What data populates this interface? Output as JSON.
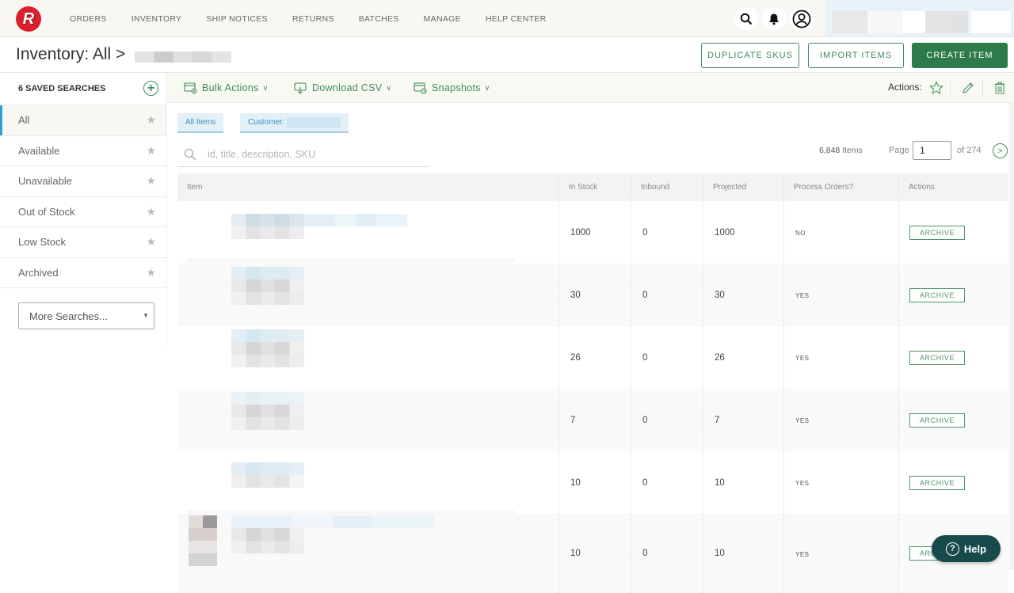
{
  "nav": {
    "logo_letter": "R",
    "items": [
      "ORDERS",
      "INVENTORY",
      "SHIP NOTICES",
      "RETURNS",
      "BATCHES",
      "MANAGE",
      "HELP CENTER"
    ],
    "icons": [
      "search-icon",
      "bell-icon",
      "user-icon"
    ]
  },
  "header": {
    "title": "Inventory: All >",
    "buttons": {
      "duplicate_skus": "DUPLICATE SKUS",
      "import_items": "IMPORT ITEMS",
      "create_item": "CREATE ITEM"
    }
  },
  "sidebar": {
    "heading": "6 SAVED SEARCHES",
    "items": [
      {
        "label": "All",
        "active": true
      },
      {
        "label": "Available"
      },
      {
        "label": "Unavailable"
      },
      {
        "label": "Out of Stock"
      },
      {
        "label": "Low Stock"
      },
      {
        "label": "Archived"
      }
    ],
    "more_searches": "More Searches..."
  },
  "toolbar": {
    "bulk_actions": "Bulk Actions",
    "download_csv": "Download CSV",
    "snapshots": "Snapshots",
    "actions_label": "Actions:"
  },
  "filters": {
    "all_items": "All Items",
    "customer": "Customer:"
  },
  "search": {
    "placeholder": "id, title, description, SKU",
    "value": ""
  },
  "pagination": {
    "items_count": "6,848",
    "items_label": "Items",
    "page_label": "Page",
    "current_page": "1",
    "of_label": "of 274"
  },
  "table": {
    "columns": [
      "Item",
      "In Stock",
      "Inbound",
      "Projected",
      "Process Orders?",
      "Actions"
    ],
    "rows": [
      {
        "in_stock": "1000",
        "inbound": "0",
        "projected": "1000",
        "process_orders": "NO",
        "action": "ARCHIVE"
      },
      {
        "in_stock": "30",
        "inbound": "0",
        "projected": "30",
        "process_orders": "YES",
        "action": "ARCHIVE"
      },
      {
        "in_stock": "26",
        "inbound": "0",
        "projected": "26",
        "process_orders": "YES",
        "action": "ARCHIVE"
      },
      {
        "in_stock": "7",
        "inbound": "0",
        "projected": "7",
        "process_orders": "YES",
        "action": "ARCHIVE"
      },
      {
        "in_stock": "10",
        "inbound": "0",
        "projected": "10",
        "process_orders": "YES",
        "action": "ARCHIVE"
      },
      {
        "in_stock": "10",
        "inbound": "0",
        "projected": "10",
        "process_orders": "YES",
        "action": "ARCHIVE"
      }
    ]
  },
  "help": {
    "label": "Help"
  },
  "colors": {
    "brand_red": "#d9202c",
    "accent_green": "#2d7b4a",
    "active_blue": "#2f9fd5",
    "help_teal": "#174a4a"
  }
}
